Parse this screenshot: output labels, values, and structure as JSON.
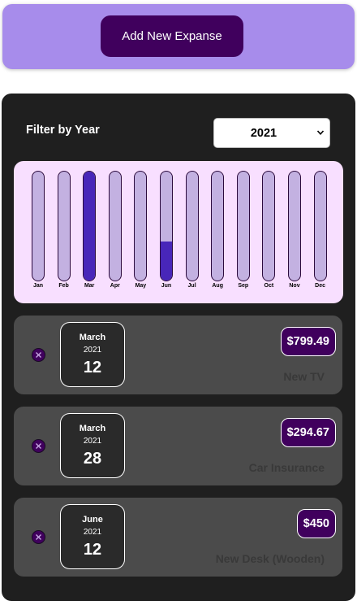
{
  "header": {
    "add_button_label": "Add New Expanse"
  },
  "filter": {
    "label": "Filter by Year",
    "selected_year": "2021"
  },
  "chart_data": {
    "type": "bar",
    "categories": [
      "Jan",
      "Feb",
      "Mar",
      "Apr",
      "May",
      "Jun",
      "Jul",
      "Aug",
      "Sep",
      "Oct",
      "Nov",
      "Dec"
    ],
    "values": [
      0,
      0,
      1.0,
      0,
      0,
      0.36,
      0,
      0,
      0,
      0,
      0,
      0
    ],
    "ylim": [
      0,
      1
    ],
    "colors": {
      "track": "#c3b1e1",
      "fill": "#4826b9",
      "background": "#f8dfff"
    }
  },
  "expenses": [
    {
      "month": "March",
      "year": "2021",
      "day": "12",
      "amount": "$799.49",
      "title": "New TV"
    },
    {
      "month": "March",
      "year": "2021",
      "day": "28",
      "amount": "$294.67",
      "title": "Car Insurance"
    },
    {
      "month": "June",
      "year": "2021",
      "day": "12",
      "amount": "$450",
      "title": "New Desk (Wooden)"
    }
  ],
  "colors": {
    "accent": "#40005d",
    "header_bg": "#a78ceb",
    "panel_bg": "#1f1f1f",
    "card_bg": "#4b4b4b"
  },
  "icons": {
    "delete": "close-circle-icon",
    "dropdown": "chevron-down-icon"
  }
}
